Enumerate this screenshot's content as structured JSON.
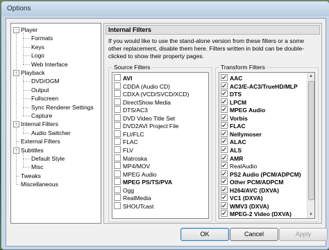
{
  "window": {
    "title": "Options"
  },
  "tree": [
    {
      "label": "Player",
      "level": 0,
      "exp": "-"
    },
    {
      "label": "Formats",
      "level": 1
    },
    {
      "label": "Keys",
      "level": 1
    },
    {
      "label": "Logo",
      "level": 1
    },
    {
      "label": "Web Interface",
      "level": 1
    },
    {
      "label": "Playback",
      "level": 0,
      "exp": "-"
    },
    {
      "label": "DVD/OGM",
      "level": 1
    },
    {
      "label": "Output",
      "level": 1
    },
    {
      "label": "Fullscreen",
      "level": 1
    },
    {
      "label": "Sync Renderer Settings",
      "level": 1
    },
    {
      "label": "Capture",
      "level": 1
    },
    {
      "label": "Internal Filters",
      "level": 0,
      "exp": "-"
    },
    {
      "label": "Audio Switcher",
      "level": 1
    },
    {
      "label": "External Filters",
      "level": 0
    },
    {
      "label": "Subtitles",
      "level": 0,
      "exp": "-"
    },
    {
      "label": "Default Style",
      "level": 1
    },
    {
      "label": "Misc",
      "level": 1
    },
    {
      "label": "Tweaks",
      "level": 0
    },
    {
      "label": "Miscellaneous",
      "level": 0
    }
  ],
  "panel": {
    "title": "Internal Filters",
    "description": "If you would like to use the stand-alone version from these filters or a some other replacement, disable them here. Filters written in bold can be double-clicked to show their property pages.",
    "source_label": "Source Filters",
    "transform_label": "Transform Filters"
  },
  "source_filters": [
    {
      "label": "AVI",
      "checked": false,
      "bold": true
    },
    {
      "label": "CDDA (Audio CD)",
      "checked": false,
      "bold": false
    },
    {
      "label": "CDXA (VCD/SVCD/XCD)",
      "checked": false,
      "bold": false
    },
    {
      "label": "DirectShow Media",
      "checked": false,
      "bold": false
    },
    {
      "label": "DTS/AC3",
      "checked": false,
      "bold": false
    },
    {
      "label": "DVD Video Title Set",
      "checked": false,
      "bold": false
    },
    {
      "label": "DVD2AVI Project File",
      "checked": false,
      "bold": false
    },
    {
      "label": "FLI/FLC",
      "checked": false,
      "bold": false
    },
    {
      "label": "FLAC",
      "checked": false,
      "bold": false
    },
    {
      "label": "FLV",
      "checked": false,
      "bold": false
    },
    {
      "label": "Matroska",
      "checked": false,
      "bold": false
    },
    {
      "label": "MP4/MOV",
      "checked": false,
      "bold": false
    },
    {
      "label": "MPEG Audio",
      "checked": false,
      "bold": false
    },
    {
      "label": "MPEG PS/TS/PVA",
      "checked": false,
      "bold": true
    },
    {
      "label": "Ogg",
      "checked": false,
      "bold": false
    },
    {
      "label": "RealMedia",
      "checked": false,
      "bold": false
    },
    {
      "label": "SHOUTcast",
      "checked": false,
      "bold": false
    }
  ],
  "transform_filters": [
    {
      "label": "AAC",
      "checked": true,
      "bold": true
    },
    {
      "label": "AC3/E-AC3/TrueHD/MLP",
      "checked": true,
      "bold": true
    },
    {
      "label": "DTS",
      "checked": true,
      "bold": true
    },
    {
      "label": "LPCM",
      "checked": true,
      "bold": true
    },
    {
      "label": "MPEG Audio",
      "checked": true,
      "bold": true
    },
    {
      "label": "Vorbis",
      "checked": true,
      "bold": true
    },
    {
      "label": "FLAC",
      "checked": true,
      "bold": true
    },
    {
      "label": "Nellymoser",
      "checked": true,
      "bold": true
    },
    {
      "label": "ALAC",
      "checked": true,
      "bold": true
    },
    {
      "label": "ALS",
      "checked": true,
      "bold": true
    },
    {
      "label": "AMR",
      "checked": true,
      "bold": true
    },
    {
      "label": "RealAudio",
      "checked": true,
      "bold": false
    },
    {
      "label": "PS2 Audio (PCM/ADPCM)",
      "checked": true,
      "bold": true
    },
    {
      "label": "Other PCM/ADPCM",
      "checked": true,
      "bold": true
    },
    {
      "label": "H264/AVC (DXVA)",
      "checked": true,
      "bold": true
    },
    {
      "label": "VC1 (DXVA)",
      "checked": true,
      "bold": true
    },
    {
      "label": "WMV3 (DXVA)",
      "checked": true,
      "bold": true
    },
    {
      "label": "MPEG-2 Video (DXVA)",
      "checked": true,
      "bold": true
    }
  ],
  "buttons": {
    "ok": "OK",
    "cancel": "Cancel",
    "apply": "Apply"
  }
}
